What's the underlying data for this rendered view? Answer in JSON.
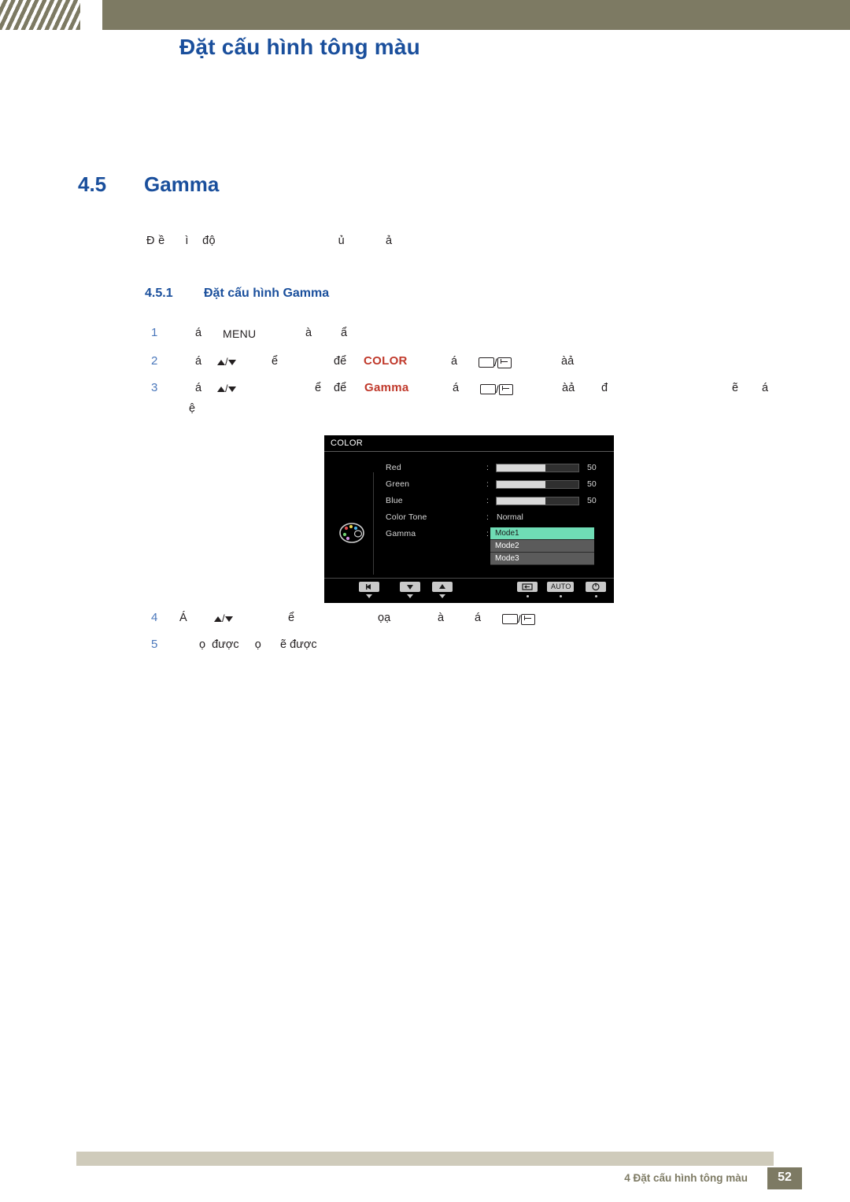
{
  "header": {
    "title": "Đặt cấu hình tông màu"
  },
  "section": {
    "number": "4.5",
    "title": "Gamma"
  },
  "intro": "Đ ề      ì    độ                                    ủ            ả",
  "subsection": {
    "number": "4.5.1",
    "title": "Đặt cấu hình Gamma"
  },
  "steps": [
    {
      "num": "1",
      "a": "á",
      "key": "MENU",
      "b": "à",
      "c": "ẩ"
    },
    {
      "num": "2",
      "a": "á",
      "b": "ể",
      "c": "để",
      "kw": "COLOR",
      "d": "á",
      "e": "àả"
    },
    {
      "num": "3",
      "a": "á",
      "b": "ể",
      "c": "để",
      "kw": "Gamma",
      "d": "á",
      "e": "àả",
      "f": "đ",
      "g": "ẽ",
      "h": "á",
      "i": "ệ"
    },
    {
      "num": "4",
      "a": "Á",
      "b": "ể",
      "c": "ọạ",
      "d": "à",
      "e": "á"
    },
    {
      "num": "5",
      "a": "ọ  được     ọ      ẽ được"
    }
  ],
  "osd": {
    "title": "COLOR",
    "rows": [
      {
        "label": "Red",
        "value": "50",
        "fill": 62
      },
      {
        "label": "Green",
        "value": "50",
        "fill": 62
      },
      {
        "label": "Blue",
        "value": "50",
        "fill": 62
      },
      {
        "label": "Color Tone",
        "value": "Normal"
      },
      {
        "label": "Gamma",
        "value": ""
      }
    ],
    "submenu": {
      "items": [
        "Mode1",
        "Mode2",
        "Mode3"
      ],
      "selected_index": 0
    },
    "buttons": {
      "auto_label": "AUTO"
    }
  },
  "footer": {
    "text": "4 Đặt cấu hình tông màu",
    "page": "52"
  },
  "colors": {
    "brand_blue": "#1a4f9c",
    "accent_red": "#c0392b",
    "band": "#7d7a63",
    "step_num": "#4a77bb",
    "osd_highlight": "#6fdcb5"
  }
}
